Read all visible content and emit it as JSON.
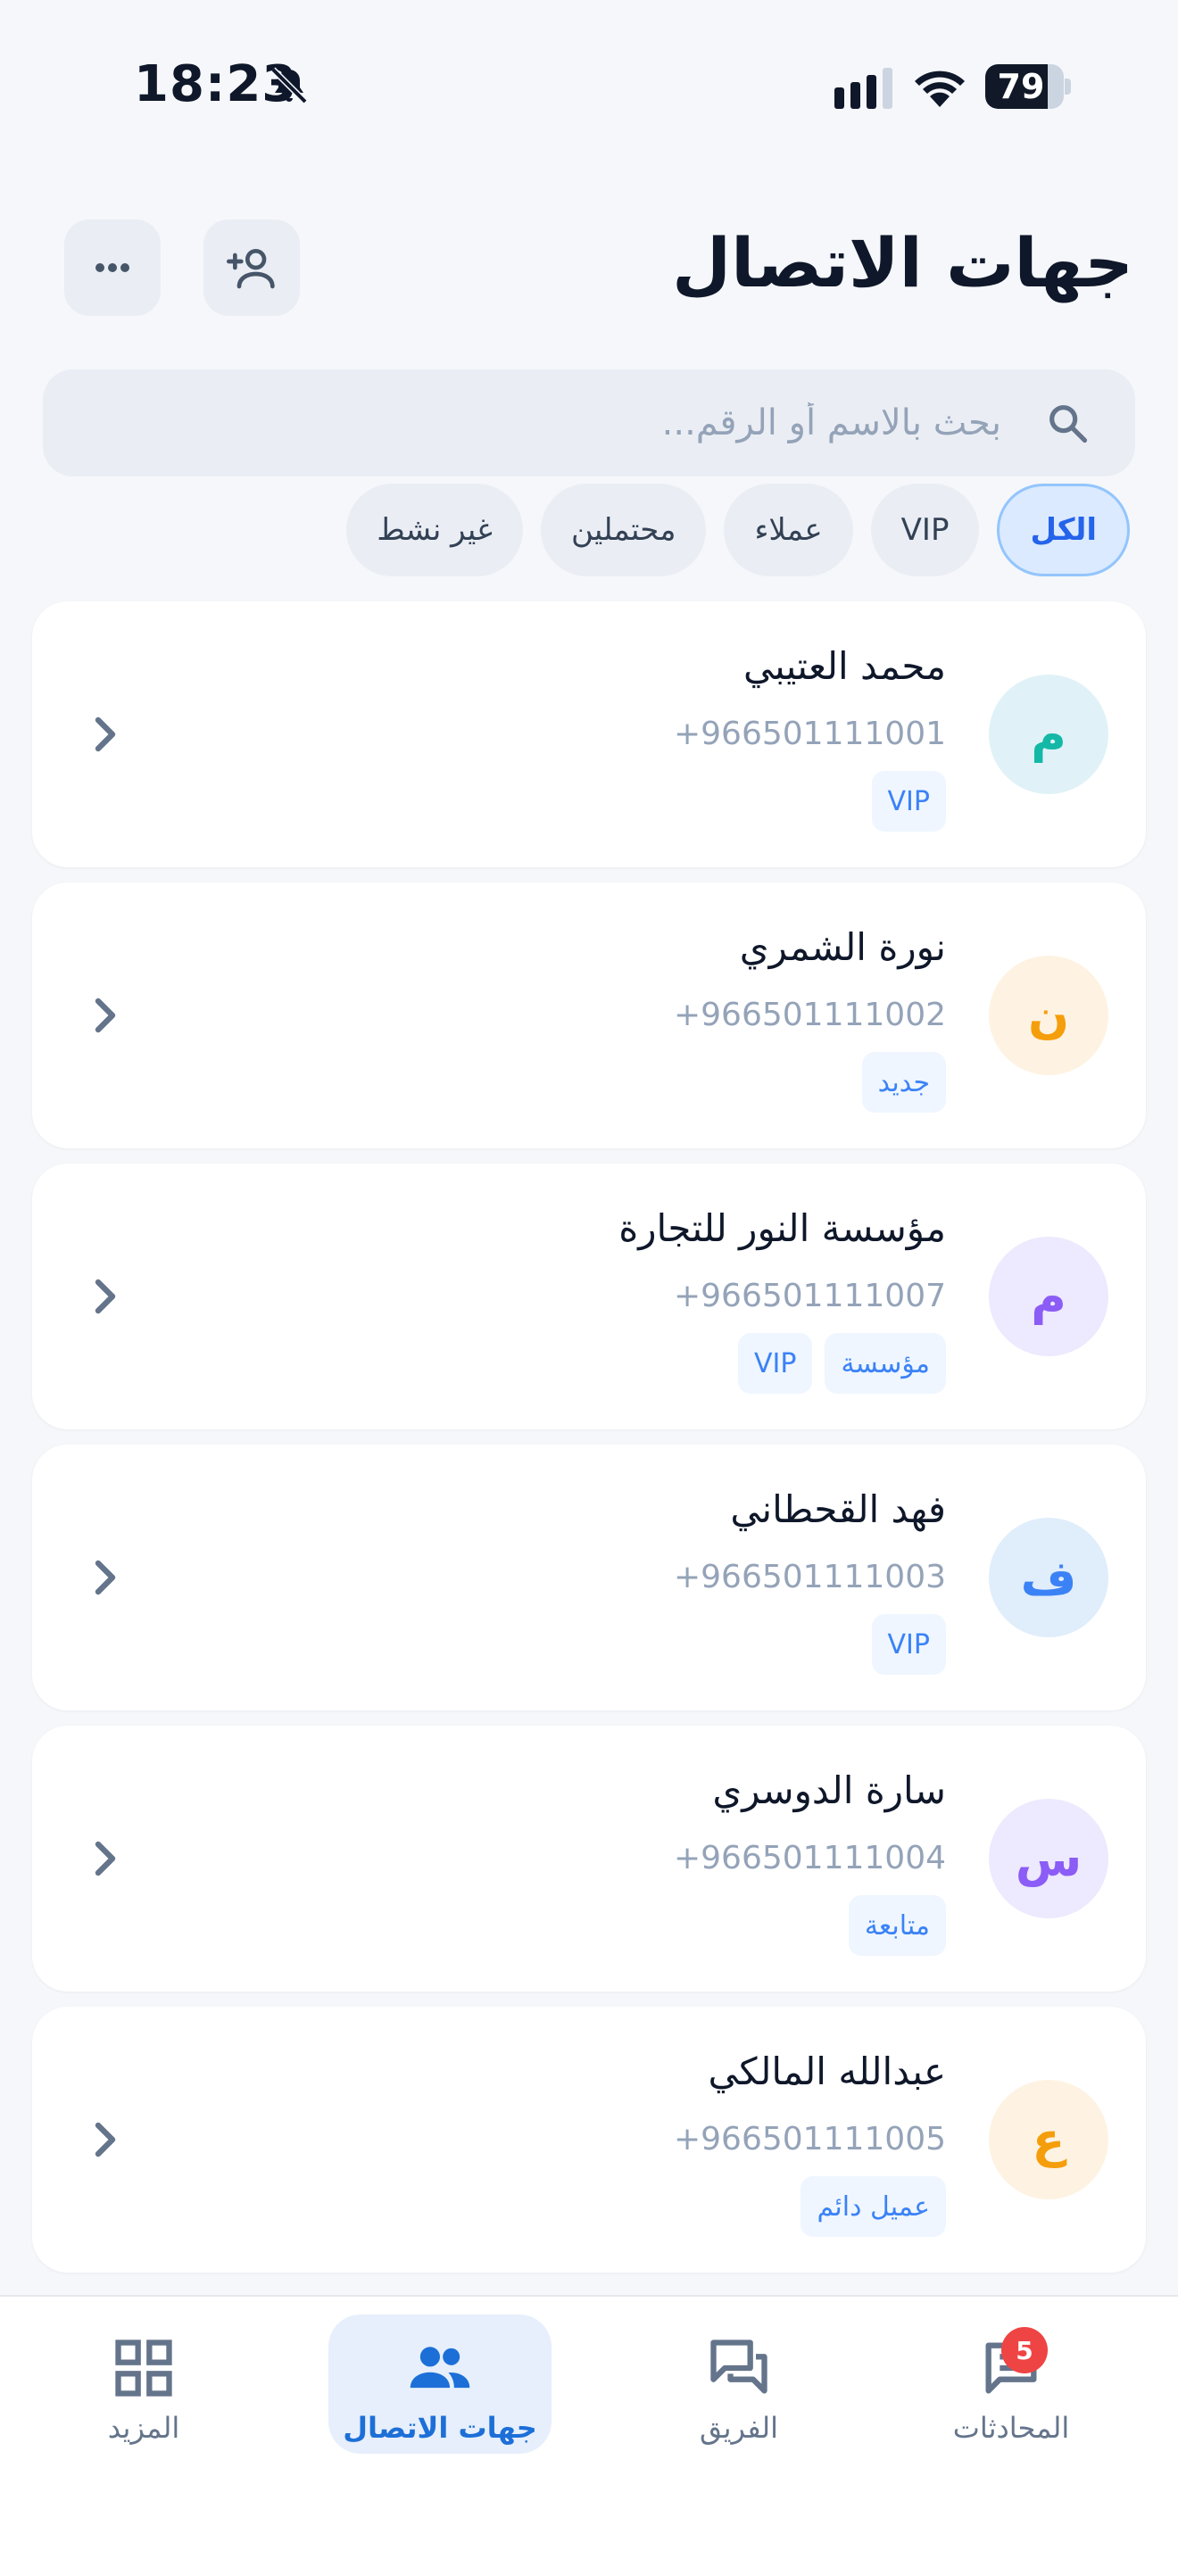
{
  "status_bar": {
    "time": "18:23",
    "battery": "79",
    "battery_level": 0.79
  },
  "header": {
    "title": "جهات الاتصال"
  },
  "search": {
    "placeholder": "بحث بالاسم أو الرقم..."
  },
  "filters": [
    {
      "label": "الكل",
      "active": true
    },
    {
      "label": "VIP",
      "active": false
    },
    {
      "label": "عملاء",
      "active": false
    },
    {
      "label": "محتملين",
      "active": false
    },
    {
      "label": "غير نشط",
      "active": false
    }
  ],
  "contacts": [
    {
      "initial": "م",
      "name": "محمد العتيبي",
      "phone": "+966501111001",
      "tags": [
        "VIP"
      ],
      "avatar_bg": "#e0f2f7",
      "avatar_fg": "#14b8a6"
    },
    {
      "initial": "ن",
      "name": "نورة الشمري",
      "phone": "+966501111002",
      "tags": [
        "جديد"
      ],
      "avatar_bg": "#fef3e2",
      "avatar_fg": "#f59e0b"
    },
    {
      "initial": "م",
      "name": "مؤسسة النور للتجارة",
      "phone": "+966501111007",
      "tags": [
        "مؤسسة",
        "VIP"
      ],
      "avatar_bg": "#ede9fe",
      "avatar_fg": "#8b5cf6"
    },
    {
      "initial": "ف",
      "name": "فهد القحطاني",
      "phone": "+966501111003",
      "tags": [
        "VIP"
      ],
      "avatar_bg": "#e0edfb",
      "avatar_fg": "#3b82f6"
    },
    {
      "initial": "س",
      "name": "سارة الدوسري",
      "phone": "+966501111004",
      "tags": [
        "متابعة"
      ],
      "avatar_bg": "#ede9fe",
      "avatar_fg": "#8b5cf6"
    },
    {
      "initial": "ع",
      "name": "عبدالله المالكي",
      "phone": "+966501111005",
      "tags": [
        "عميل دائم"
      ],
      "avatar_bg": "#fef3e2",
      "avatar_fg": "#f59e0b"
    }
  ],
  "bottom_nav": {
    "items": [
      {
        "label": "المحادثات",
        "icon": "chat-icon",
        "active": false,
        "badge": "5"
      },
      {
        "label": "الفريق",
        "icon": "team-chat-icon",
        "active": false
      },
      {
        "label": "جهات الاتصال",
        "icon": "people-icon",
        "active": true
      },
      {
        "label": "المزيد",
        "icon": "grid-icon",
        "active": false
      }
    ]
  },
  "colors": {
    "accent": "#1d6fd8",
    "tag_text": "#3b82f6",
    "badge": "#ef4444"
  }
}
